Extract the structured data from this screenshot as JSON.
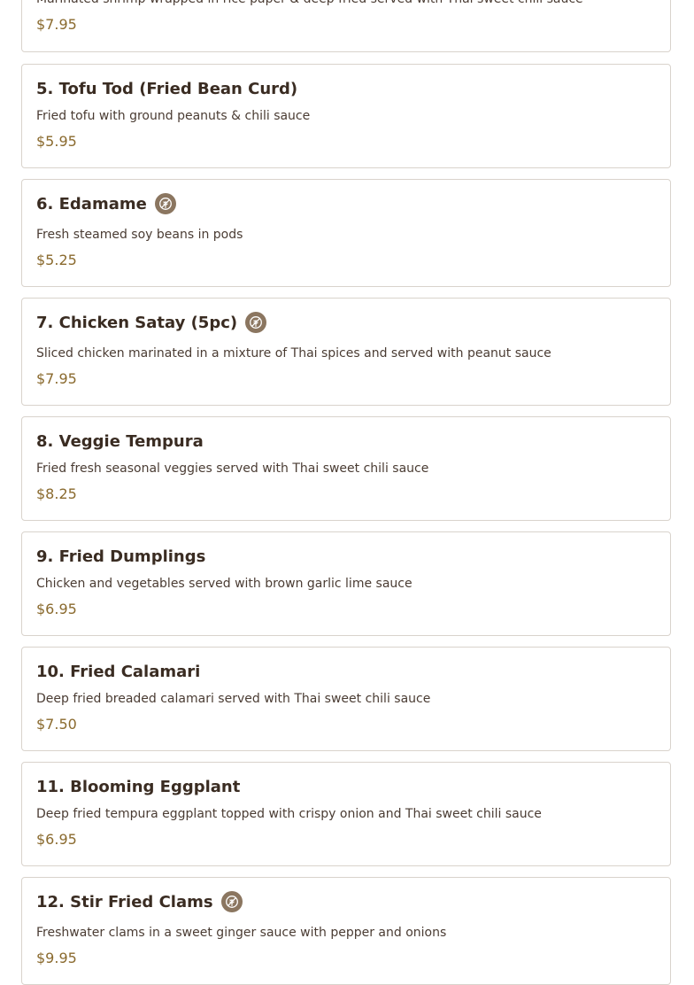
{
  "menu": {
    "items": [
      {
        "title": "",
        "description": "Marinated shrimp wrapped in rice paper & deep fried served with Thai sweet chili sauce",
        "price": "$7.95",
        "badge": false
      },
      {
        "title": "5. Tofu Tod (Fried Bean Curd)",
        "description": "Fried tofu with ground peanuts & chili sauce",
        "price": "$5.95",
        "badge": false
      },
      {
        "title": "6. Edamame",
        "description": "Fresh steamed soy beans in pods",
        "price": "$5.25",
        "badge": true,
        "badge_icon": "gluten-free-icon"
      },
      {
        "title": "7. Chicken Satay (5pc)",
        "description": "Sliced chicken marinated in a mixture of Thai spices and served with peanut sauce",
        "price": "$7.95",
        "badge": true,
        "badge_icon": "gluten-free-icon"
      },
      {
        "title": "8. Veggie Tempura",
        "description": "Fried fresh seasonal veggies served with Thai sweet chili sauce",
        "price": "$8.25",
        "badge": false
      },
      {
        "title": "9. Fried Dumplings",
        "description": "Chicken and vegetables served with brown garlic lime sauce",
        "price": "$6.95",
        "badge": false
      },
      {
        "title": "10. Fried Calamari",
        "description": "Deep fried breaded calamari served with Thai sweet chili sauce",
        "price": "$7.50",
        "badge": false
      },
      {
        "title": "11. Blooming Eggplant",
        "description": "Deep fried tempura eggplant topped with crispy onion and Thai sweet chili sauce",
        "price": "$6.95",
        "badge": false
      },
      {
        "title": "12. Stir Fried Clams",
        "description": "Freshwater clams in a sweet ginger sauce with pepper and onions",
        "price": "$9.95",
        "badge": true,
        "badge_icon": "gluten-free-icon"
      }
    ]
  },
  "colors": {
    "price": "#8a6a2e",
    "badge": "#8b7660",
    "border": "#d9d3cc",
    "title": "#3a2c22"
  }
}
